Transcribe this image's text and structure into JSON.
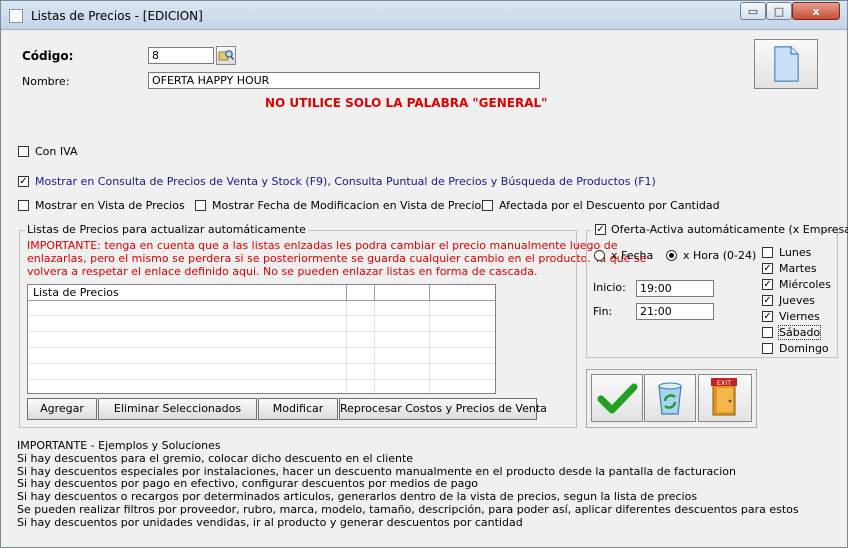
{
  "window": {
    "title": "Listas de Precios - [EDICION]",
    "minimize_glyph": "▭",
    "maximize_glyph": "□",
    "close_glyph": "x"
  },
  "form": {
    "codigo_label": "Código:",
    "codigo_value": "8",
    "nombre_label": "Nombre:",
    "nombre_value": "OFERTA HAPPY HOUR",
    "warning": "NO UTILICE SOLO LA PALABRA \"GENERAL\""
  },
  "options": {
    "con_iva": {
      "label": "Con IVA",
      "checked": false
    },
    "mostrar_consulta": {
      "label": "Mostrar en Consulta de Precios de Venta y Stock (F9), Consulta Puntual de Precios y Búsqueda de Productos (F1)",
      "checked": true
    },
    "mostrar_vista": {
      "label": "Mostrar en Vista de Precios",
      "checked": false
    },
    "mostrar_fecha": {
      "label": "Mostrar Fecha de Modificacion en Vista de Precios",
      "checked": false
    },
    "afectada": {
      "label": "Afectada por el Descuento por Cantidad",
      "checked": false
    }
  },
  "listas_group": {
    "title": "Listas de Precios para actualizar automáticamente",
    "important_lines": [
      "IMPORTANTE: tenga en cuenta que a las listas enlzadas les podra cambiar el precio manualmente luego de",
      "enlazarlas, pero el mismo se perdera si se posteriormente se guarda cualquier cambio en el producto. Ya que se",
      "volvera a respetar el enlace definido aqui. No se pueden enlazar listas en forma de cascada."
    ],
    "grid_header": "Lista de Precios",
    "buttons": {
      "agregar": "Agregar",
      "eliminar": "Eliminar Seleccionados",
      "modificar": "Modificar",
      "reprocesar": "Reprocesar Costos y Precios de Venta"
    }
  },
  "oferta": {
    "label": "Oferta-Activa automáticamente (x Empresa)",
    "checked": true,
    "x_fecha": "x Fecha",
    "x_hora": "x Hora (0-24)",
    "selected_mode": "x Hora (0-24)",
    "inicio_label": "Inicio:",
    "inicio_value": "19:00",
    "fin_label": "Fin:",
    "fin_value": "21:00",
    "days": [
      {
        "name": "Lunes",
        "checked": false
      },
      {
        "name": "Martes",
        "checked": true
      },
      {
        "name": "Miércoles",
        "checked": true
      },
      {
        "name": "Jueves",
        "checked": true
      },
      {
        "name": "Viernes",
        "checked": true
      },
      {
        "name": "Sábado",
        "checked": false
      },
      {
        "name": "Domingo",
        "checked": false
      }
    ]
  },
  "actions": {
    "exit_text": "EXIT"
  },
  "notes": [
    "IMPORTANTE - Ejemplos y Soluciones",
    "Si hay descuentos para el gremio, colocar dicho descuento en el cliente",
    "Si hay descuentos especiales por instalaciones, hacer un descuento manualmente en el producto desde la pantalla de facturacion",
    "Si hay descuentos por pago en efectivo, configurar descuentos por medios de pago",
    "Si hay descuentos o recargos por determinados articulos, generarlos dentro de la vista de precios, segun la lista de precios",
    "Se pueden realizar filtros por proveedor, rubro, marca, modelo, tamaño, descripción, para poder así, aplicar diferentes descuentos para estos",
    "Si hay descuentos por unidades vendidas, ir al producto y generar descuentos por cantidad"
  ],
  "colors": {
    "warning": "#e10000",
    "link_blue": "#1a1a8c",
    "ok_green": "#22a022"
  }
}
